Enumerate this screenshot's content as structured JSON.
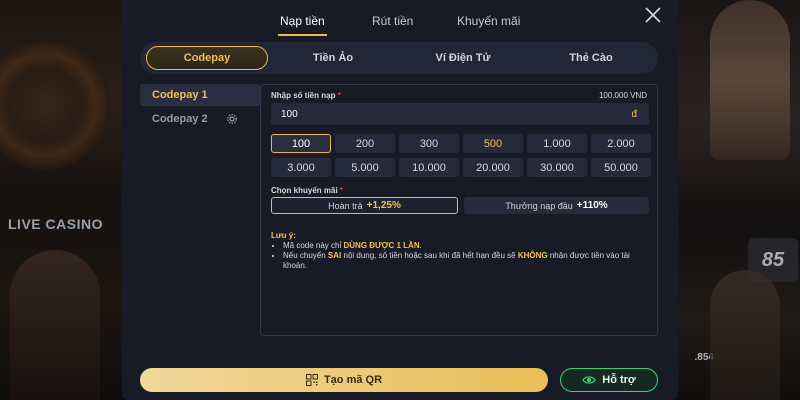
{
  "background": {
    "live_label": "LIVE CASINO",
    "badge": "85",
    "side_number": ".854"
  },
  "top_tabs": [
    {
      "label": "Nạp tiền",
      "active": true
    },
    {
      "label": "Rút tiền",
      "active": false
    },
    {
      "label": "Khuyến mãi",
      "active": false
    }
  ],
  "methods": [
    {
      "label": "Codepay",
      "active": true
    },
    {
      "label": "Tiền Ảo",
      "active": false
    },
    {
      "label": "Ví Điện Tử",
      "active": false
    },
    {
      "label": "Thẻ Cào",
      "active": false
    }
  ],
  "side": [
    {
      "label": "Codepay 1",
      "active": true
    },
    {
      "label": "Codepay 2",
      "active": false,
      "icon": "settings-gear-icon"
    }
  ],
  "form": {
    "amount_label": "Nhập số tiền nạp",
    "required_mark": "*",
    "max_amount": "100.000 VND",
    "amount_value": "100",
    "currency": "đ",
    "amounts": [
      "100",
      "200",
      "300",
      "500",
      "1.000",
      "2.000",
      "3.000",
      "5.000",
      "10.000",
      "20.000",
      "30.000",
      "50.000"
    ],
    "selected_amount": "100",
    "promo_label": "Chọn khuyến mãi",
    "promos": [
      {
        "label": "Hoàn trả",
        "value": "+1,25%",
        "active": true
      },
      {
        "label": "Thưởng nạp đầu",
        "value": "+110%",
        "active": false
      }
    ]
  },
  "note": {
    "title": "Lưu ý:",
    "line1_a": "Mã code này chỉ ",
    "line1_b": "DÙNG ĐƯỢC 1 LẦN",
    "line1_c": ".",
    "line2_a": "Nếu chuyển ",
    "line2_b": "SAI",
    "line2_c": " nội dung, số tiền hoặc sau khi đã hết hạn đều sẽ ",
    "line2_d": "KHÔNG",
    "line2_e": " nhận được tiền vào tài khoản."
  },
  "buttons": {
    "qr": "Tạo mã QR",
    "support": "Hỗ trợ"
  },
  "colors": {
    "accent": "#e9b94a",
    "support": "#3ccf7a",
    "modal_bg": "#181a25"
  }
}
